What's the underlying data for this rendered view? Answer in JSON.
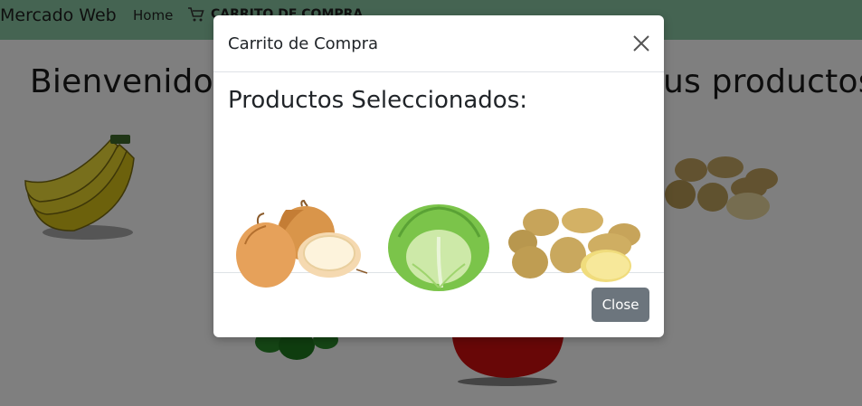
{
  "navbar": {
    "brand": "Mercado Web",
    "home_label": "Home",
    "cart_label": "CARRITO DE COMPRA",
    "bg_color": "#8bc8a4"
  },
  "hero": {
    "title_left": "Bienvenido a",
    "title_right": "us productos"
  },
  "background_products": [
    "banana",
    "green-pepper",
    "tomato",
    "potatoes"
  ],
  "modal": {
    "title": "Carrito de Compra",
    "heading": "Productos Seleccionados:",
    "products": [
      "onion",
      "lettuce",
      "potatoes"
    ],
    "close_button_label": "Close",
    "close_icon": "close-icon",
    "button_color": "#6c757d"
  }
}
